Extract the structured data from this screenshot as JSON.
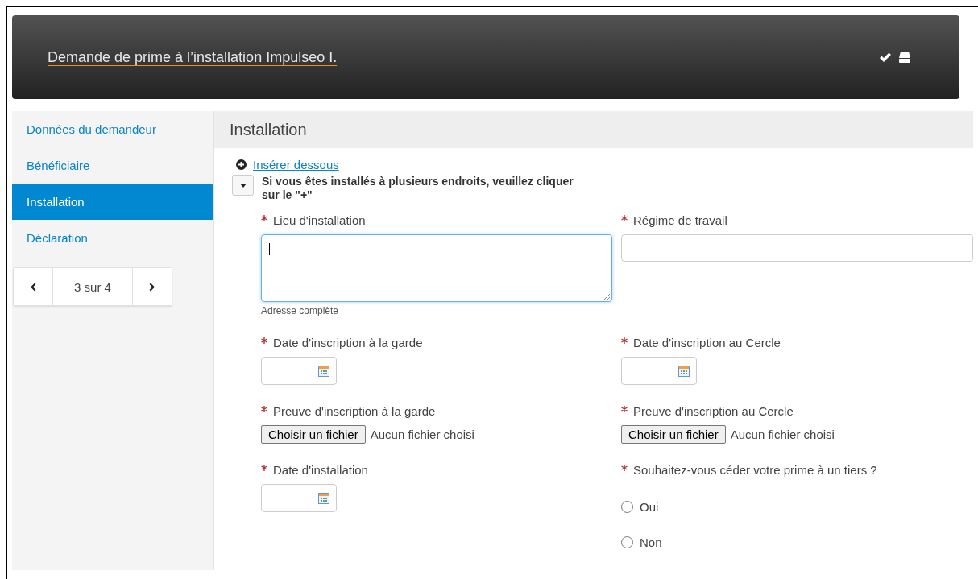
{
  "header": {
    "title": "Demande de prime à l’installation Impulseo I."
  },
  "sidebar": {
    "items": [
      {
        "label": "Données du demandeur",
        "selected": false
      },
      {
        "label": "Bénéficiaire",
        "selected": false
      },
      {
        "label": "Installation",
        "selected": true
      },
      {
        "label": "Déclaration",
        "selected": false
      }
    ],
    "pager": {
      "text": "3 sur 4"
    }
  },
  "section": {
    "title": "Installation",
    "insert_link": "Insérer dessous",
    "note": "Si vous êtes installés à plusieurs endroits, veuillez cliquer sur le \"+\"",
    "fields": [
      {
        "kind": "textarea",
        "label": "Lieu d'installation",
        "required": true,
        "focused": true,
        "hint": "Adresse complète"
      },
      {
        "kind": "text",
        "label": "Régime de travail",
        "required": true,
        "focused": false
      },
      {
        "kind": "date",
        "label": "Date d'inscription à la garde",
        "required": true
      },
      {
        "kind": "date",
        "label": "Date d'inscription au Cercle",
        "required": true
      },
      {
        "kind": "file",
        "label": "Preuve d'inscription à la garde",
        "required": true,
        "button": "Choisir un fichier",
        "status": "Aucun fichier choisi"
      },
      {
        "kind": "file",
        "label": "Preuve d'inscription au Cercle",
        "required": true,
        "button": "Choisir un fichier",
        "status": "Aucun fichier choisi"
      },
      {
        "kind": "date",
        "label": "Date d'installation",
        "required": true
      },
      {
        "kind": "radio",
        "label": "Souhaitez-vous céder votre prime à un tiers ?",
        "required": true,
        "options": [
          {
            "label": "Oui",
            "selected": false
          },
          {
            "label": "Non",
            "selected": false
          }
        ]
      }
    ]
  }
}
